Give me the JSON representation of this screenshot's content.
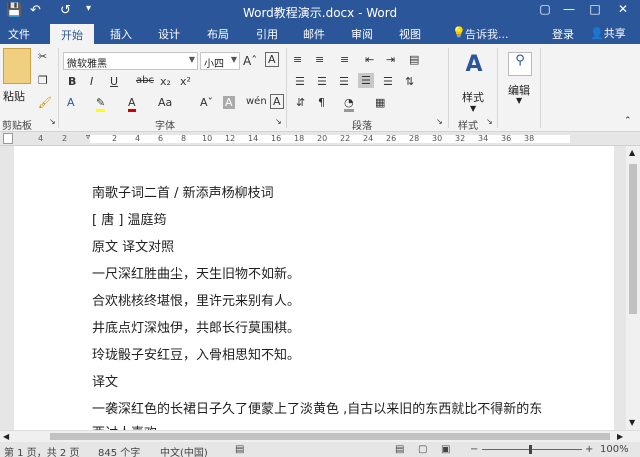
{
  "window": {
    "title": "Word教程演示.docx - Word",
    "save_icon": "save-icon",
    "undo_icon": "undo-icon",
    "redo_icon": "redo-icon"
  },
  "tabs": [
    "文件",
    "开始",
    "插入",
    "设计",
    "布局",
    "引用",
    "邮件",
    "审阅",
    "视图"
  ],
  "tell_me": "告诉我...",
  "account": {
    "login": "登录",
    "share": "共享"
  },
  "ribbon": {
    "clipboard": {
      "paste": "粘贴",
      "label": "剪贴板"
    },
    "font": {
      "name": "微软雅黑",
      "size": "小四",
      "label": "字体",
      "bold": "B",
      "italic": "I",
      "underline": "U",
      "strike": "abc",
      "sub": "x₂",
      "sup": "x²"
    },
    "paragraph": {
      "label": "段落"
    },
    "styles": {
      "button": "样式",
      "label": "样式"
    },
    "editing": {
      "button": "编辑"
    }
  },
  "ruler": [
    "4",
    "2",
    "2",
    "4",
    "6",
    "8",
    "10",
    "12",
    "14",
    "16",
    "18",
    "20",
    "22",
    "24",
    "26",
    "28",
    "30",
    "32",
    "34",
    "36",
    "38"
  ],
  "document": {
    "lines": [
      "南歌子词二首 / 新添声杨柳枝词",
      "[ 唐 ] 温庭筠",
      "原文  译文对照",
      "一尺深红胜曲尘，天生旧物不如新。",
      "合欢桃核终堪恨，里许元来别有人。",
      "井底点灯深烛伊，共郎长行莫围棋。",
      "玲珑骰子安红豆，入骨相思知不知。",
      "译文",
      "一袭深红色的长裙日子久了便蒙上了淡黄色 ,自古以来旧的东西就比不得新的东",
      "西讨人喜欢"
    ]
  },
  "status": {
    "page": "第 1 页，共 2 页",
    "words": "845 个字",
    "lang": "中文(中国)",
    "zoom": "100%"
  }
}
